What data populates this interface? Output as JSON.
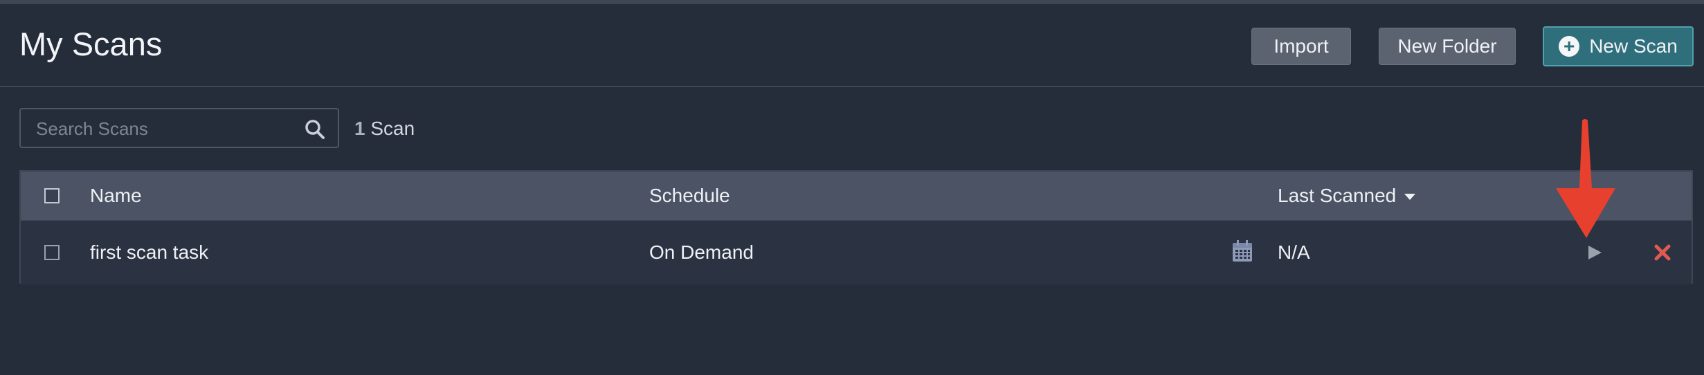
{
  "header": {
    "title": "My Scans",
    "import_label": "Import",
    "new_folder_label": "New Folder",
    "new_scan_label": "New Scan"
  },
  "search": {
    "placeholder": "Search Scans",
    "value": ""
  },
  "scan_count": {
    "number": "1",
    "unit": "Scan"
  },
  "table": {
    "columns": {
      "name": "Name",
      "schedule": "Schedule",
      "last_scanned": "Last Scanned"
    },
    "sort": {
      "column": "last_scanned",
      "direction": "descending"
    },
    "rows": [
      {
        "name": "first scan task",
        "schedule": "On Demand",
        "last_scanned": "N/A"
      }
    ]
  },
  "icons": {
    "search": "search-icon",
    "schedule": "calendar-icon",
    "launch": "play-icon",
    "delete": "close-icon",
    "new_scan": "plus-circle-icon",
    "annotation": "red-arrow-down"
  },
  "colors": {
    "background": "#252c3a",
    "header_row": "#4b5364",
    "primary_button": "#2f6f7c",
    "delete_icon": "#e05a4f",
    "annotation_arrow": "#e8402e"
  }
}
